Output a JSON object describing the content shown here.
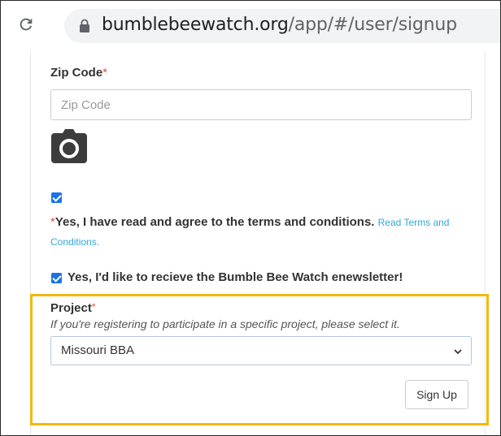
{
  "browser": {
    "url_domain": "bumblebeewatch.org",
    "url_path": "/app/#/user/signup"
  },
  "form": {
    "zip": {
      "label": "Zip Code",
      "required_mark": "*",
      "placeholder": "Zip Code",
      "value": ""
    },
    "terms": {
      "checked": true,
      "required_mark": "*",
      "text": "Yes, I have read and agree to the terms and conditions.",
      "link_text": "Read Terms and Conditions."
    },
    "newsletter": {
      "checked": true,
      "text": "Yes, I'd like to recieve the Bumble Bee Watch enewsletter!"
    },
    "project": {
      "label": "Project",
      "required_mark": "*",
      "help_text": "If you're registering to participate in a specific project, please select it.",
      "selected": "Missouri BBA"
    },
    "submit_label": "Sign Up"
  },
  "icons": {
    "reload": "reload-icon",
    "lock": "lock-icon",
    "camera": "camera-icon",
    "chevron": "chevron-down-icon"
  },
  "colors": {
    "highlight_border": "#f2b90f",
    "checkbox": "#1a73e8",
    "link": "#2fa7dc",
    "required": "#e74c3c"
  }
}
